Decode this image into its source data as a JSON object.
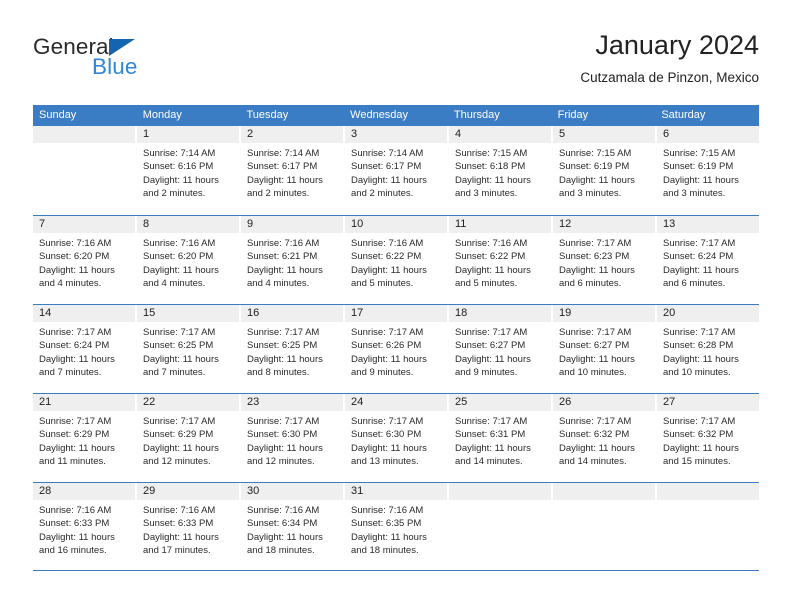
{
  "brand": {
    "name_part1": "General",
    "name_part2": "Blue",
    "triangle_color": "#1464af",
    "blue_color": "#2e86d4"
  },
  "header": {
    "title": "January 2024",
    "subtitle": "Cutzamala de Pinzon, Mexico"
  },
  "theme": {
    "header_blue": "#3b7dc4",
    "day_band_gray": "#efefef"
  },
  "weekdays": [
    "Sunday",
    "Monday",
    "Tuesday",
    "Wednesday",
    "Thursday",
    "Friday",
    "Saturday"
  ],
  "weeks": [
    [
      {
        "day": "",
        "sunrise": "",
        "sunset": "",
        "daylight_line1": "",
        "daylight_line2": ""
      },
      {
        "day": "1",
        "sunrise": "Sunrise: 7:14 AM",
        "sunset": "Sunset: 6:16 PM",
        "daylight_line1": "Daylight: 11 hours",
        "daylight_line2": "and 2 minutes."
      },
      {
        "day": "2",
        "sunrise": "Sunrise: 7:14 AM",
        "sunset": "Sunset: 6:17 PM",
        "daylight_line1": "Daylight: 11 hours",
        "daylight_line2": "and 2 minutes."
      },
      {
        "day": "3",
        "sunrise": "Sunrise: 7:14 AM",
        "sunset": "Sunset: 6:17 PM",
        "daylight_line1": "Daylight: 11 hours",
        "daylight_line2": "and 2 minutes."
      },
      {
        "day": "4",
        "sunrise": "Sunrise: 7:15 AM",
        "sunset": "Sunset: 6:18 PM",
        "daylight_line1": "Daylight: 11 hours",
        "daylight_line2": "and 3 minutes."
      },
      {
        "day": "5",
        "sunrise": "Sunrise: 7:15 AM",
        "sunset": "Sunset: 6:19 PM",
        "daylight_line1": "Daylight: 11 hours",
        "daylight_line2": "and 3 minutes."
      },
      {
        "day": "6",
        "sunrise": "Sunrise: 7:15 AM",
        "sunset": "Sunset: 6:19 PM",
        "daylight_line1": "Daylight: 11 hours",
        "daylight_line2": "and 3 minutes."
      }
    ],
    [
      {
        "day": "7",
        "sunrise": "Sunrise: 7:16 AM",
        "sunset": "Sunset: 6:20 PM",
        "daylight_line1": "Daylight: 11 hours",
        "daylight_line2": "and 4 minutes."
      },
      {
        "day": "8",
        "sunrise": "Sunrise: 7:16 AM",
        "sunset": "Sunset: 6:20 PM",
        "daylight_line1": "Daylight: 11 hours",
        "daylight_line2": "and 4 minutes."
      },
      {
        "day": "9",
        "sunrise": "Sunrise: 7:16 AM",
        "sunset": "Sunset: 6:21 PM",
        "daylight_line1": "Daylight: 11 hours",
        "daylight_line2": "and 4 minutes."
      },
      {
        "day": "10",
        "sunrise": "Sunrise: 7:16 AM",
        "sunset": "Sunset: 6:22 PM",
        "daylight_line1": "Daylight: 11 hours",
        "daylight_line2": "and 5 minutes."
      },
      {
        "day": "11",
        "sunrise": "Sunrise: 7:16 AM",
        "sunset": "Sunset: 6:22 PM",
        "daylight_line1": "Daylight: 11 hours",
        "daylight_line2": "and 5 minutes."
      },
      {
        "day": "12",
        "sunrise": "Sunrise: 7:17 AM",
        "sunset": "Sunset: 6:23 PM",
        "daylight_line1": "Daylight: 11 hours",
        "daylight_line2": "and 6 minutes."
      },
      {
        "day": "13",
        "sunrise": "Sunrise: 7:17 AM",
        "sunset": "Sunset: 6:24 PM",
        "daylight_line1": "Daylight: 11 hours",
        "daylight_line2": "and 6 minutes."
      }
    ],
    [
      {
        "day": "14",
        "sunrise": "Sunrise: 7:17 AM",
        "sunset": "Sunset: 6:24 PM",
        "daylight_line1": "Daylight: 11 hours",
        "daylight_line2": "and 7 minutes."
      },
      {
        "day": "15",
        "sunrise": "Sunrise: 7:17 AM",
        "sunset": "Sunset: 6:25 PM",
        "daylight_line1": "Daylight: 11 hours",
        "daylight_line2": "and 7 minutes."
      },
      {
        "day": "16",
        "sunrise": "Sunrise: 7:17 AM",
        "sunset": "Sunset: 6:25 PM",
        "daylight_line1": "Daylight: 11 hours",
        "daylight_line2": "and 8 minutes."
      },
      {
        "day": "17",
        "sunrise": "Sunrise: 7:17 AM",
        "sunset": "Sunset: 6:26 PM",
        "daylight_line1": "Daylight: 11 hours",
        "daylight_line2": "and 9 minutes."
      },
      {
        "day": "18",
        "sunrise": "Sunrise: 7:17 AM",
        "sunset": "Sunset: 6:27 PM",
        "daylight_line1": "Daylight: 11 hours",
        "daylight_line2": "and 9 minutes."
      },
      {
        "day": "19",
        "sunrise": "Sunrise: 7:17 AM",
        "sunset": "Sunset: 6:27 PM",
        "daylight_line1": "Daylight: 11 hours",
        "daylight_line2": "and 10 minutes."
      },
      {
        "day": "20",
        "sunrise": "Sunrise: 7:17 AM",
        "sunset": "Sunset: 6:28 PM",
        "daylight_line1": "Daylight: 11 hours",
        "daylight_line2": "and 10 minutes."
      }
    ],
    [
      {
        "day": "21",
        "sunrise": "Sunrise: 7:17 AM",
        "sunset": "Sunset: 6:29 PM",
        "daylight_line1": "Daylight: 11 hours",
        "daylight_line2": "and 11 minutes."
      },
      {
        "day": "22",
        "sunrise": "Sunrise: 7:17 AM",
        "sunset": "Sunset: 6:29 PM",
        "daylight_line1": "Daylight: 11 hours",
        "daylight_line2": "and 12 minutes."
      },
      {
        "day": "23",
        "sunrise": "Sunrise: 7:17 AM",
        "sunset": "Sunset: 6:30 PM",
        "daylight_line1": "Daylight: 11 hours",
        "daylight_line2": "and 12 minutes."
      },
      {
        "day": "24",
        "sunrise": "Sunrise: 7:17 AM",
        "sunset": "Sunset: 6:30 PM",
        "daylight_line1": "Daylight: 11 hours",
        "daylight_line2": "and 13 minutes."
      },
      {
        "day": "25",
        "sunrise": "Sunrise: 7:17 AM",
        "sunset": "Sunset: 6:31 PM",
        "daylight_line1": "Daylight: 11 hours",
        "daylight_line2": "and 14 minutes."
      },
      {
        "day": "26",
        "sunrise": "Sunrise: 7:17 AM",
        "sunset": "Sunset: 6:32 PM",
        "daylight_line1": "Daylight: 11 hours",
        "daylight_line2": "and 14 minutes."
      },
      {
        "day": "27",
        "sunrise": "Sunrise: 7:17 AM",
        "sunset": "Sunset: 6:32 PM",
        "daylight_line1": "Daylight: 11 hours",
        "daylight_line2": "and 15 minutes."
      }
    ],
    [
      {
        "day": "28",
        "sunrise": "Sunrise: 7:16 AM",
        "sunset": "Sunset: 6:33 PM",
        "daylight_line1": "Daylight: 11 hours",
        "daylight_line2": "and 16 minutes."
      },
      {
        "day": "29",
        "sunrise": "Sunrise: 7:16 AM",
        "sunset": "Sunset: 6:33 PM",
        "daylight_line1": "Daylight: 11 hours",
        "daylight_line2": "and 17 minutes."
      },
      {
        "day": "30",
        "sunrise": "Sunrise: 7:16 AM",
        "sunset": "Sunset: 6:34 PM",
        "daylight_line1": "Daylight: 11 hours",
        "daylight_line2": "and 18 minutes."
      },
      {
        "day": "31",
        "sunrise": "Sunrise: 7:16 AM",
        "sunset": "Sunset: 6:35 PM",
        "daylight_line1": "Daylight: 11 hours",
        "daylight_line2": "and 18 minutes."
      },
      {
        "day": "",
        "sunrise": "",
        "sunset": "",
        "daylight_line1": "",
        "daylight_line2": ""
      },
      {
        "day": "",
        "sunrise": "",
        "sunset": "",
        "daylight_line1": "",
        "daylight_line2": ""
      },
      {
        "day": "",
        "sunrise": "",
        "sunset": "",
        "daylight_line1": "",
        "daylight_line2": ""
      }
    ]
  ]
}
